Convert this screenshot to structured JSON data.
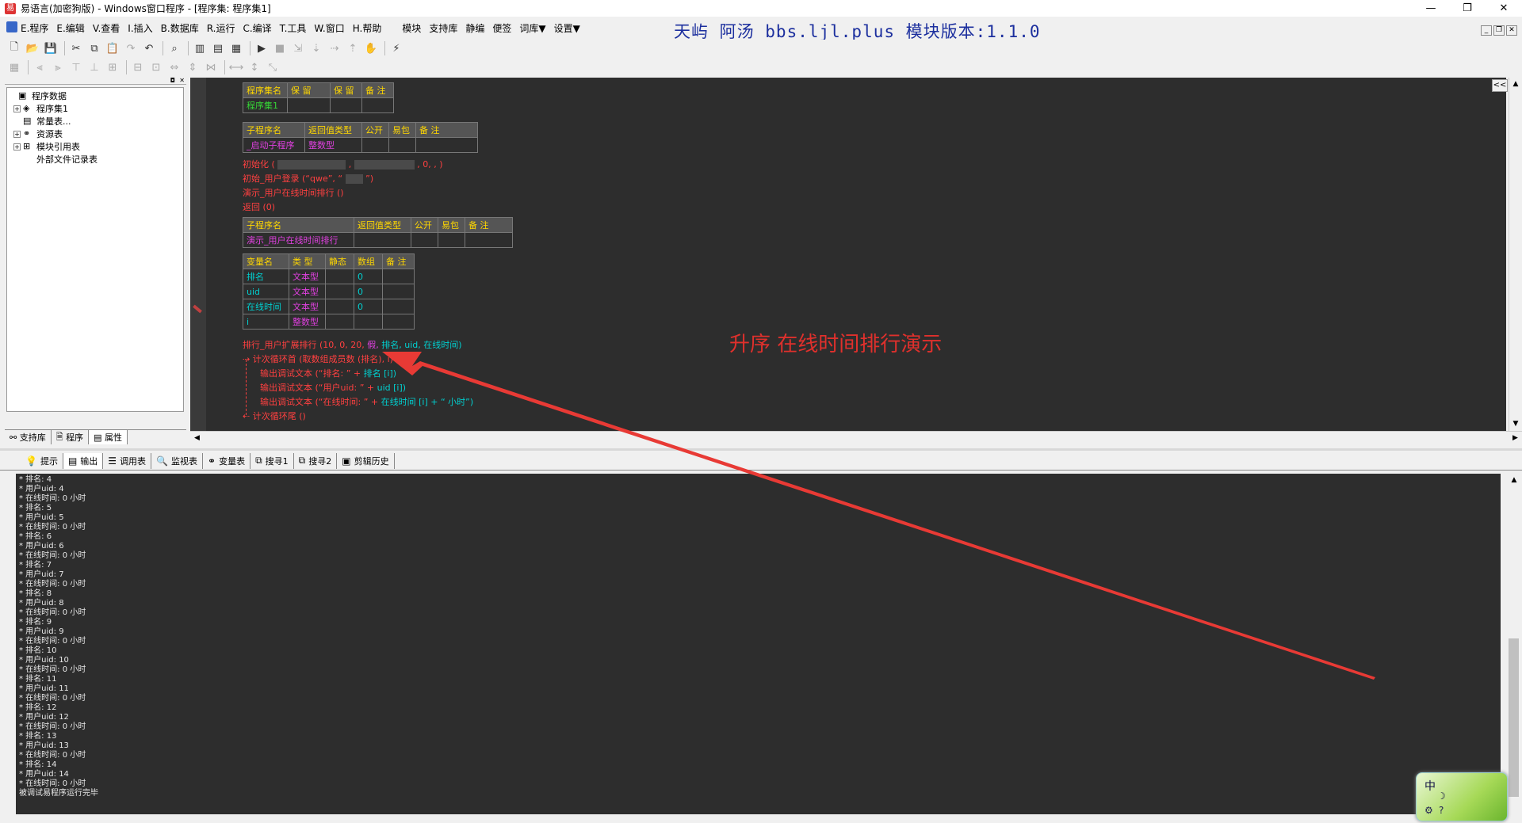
{
  "window": {
    "title": "易语言(加密狗版) - Windows窗口程序 - [程序集: 程序集1]",
    "minimize": "—",
    "restore": "❐",
    "close": "✕"
  },
  "menu": {
    "items": [
      "E.程序",
      "E.编辑",
      "V.查看",
      "I.插入",
      "B.数据库",
      "R.运行",
      "C.编译",
      "T.工具",
      "W.窗口",
      "H.帮助",
      "模块",
      "支持库",
      "静编",
      "便签",
      "词库▼",
      "设置▼"
    ],
    "banner": "天屿_阿汤 bbs.ljl.plus 模块版本:1.1.0",
    "mdi": [
      "_",
      "❐",
      "✕"
    ]
  },
  "left_panel": {
    "tree": [
      {
        "label": "程序数据",
        "icon": "▣",
        "level": 0,
        "exp": ""
      },
      {
        "label": "程序集1",
        "icon": "◈",
        "level": 1,
        "exp": "+"
      },
      {
        "label": "常量表...",
        "icon": "▤",
        "level": 1,
        "exp": ""
      },
      {
        "label": "资源表",
        "icon": "⚭",
        "level": 1,
        "exp": "+"
      },
      {
        "label": "模块引用表",
        "icon": "⊞",
        "level": 1,
        "exp": "+"
      },
      {
        "label": "外部文件记录表",
        "icon": "",
        "level": 1,
        "exp": ""
      }
    ],
    "tabs": [
      "支持库",
      "程序",
      "属性"
    ]
  },
  "editor": {
    "t1_headers": [
      "程序集名",
      "保 留",
      "保 留",
      "备 注"
    ],
    "t1_row": [
      "程序集1",
      "",
      "",
      ""
    ],
    "t2_headers": [
      "子程序名",
      "返回值类型",
      "公开",
      "易包",
      "备 注"
    ],
    "t2_row": [
      "_启动子程序",
      "整数型",
      "",
      "",
      ""
    ],
    "line_init_a": "初始化 (",
    "line_init_b": ",",
    "line_init_c": ", 0, , )",
    "line_login_a": "初始_用户登录 (“qwe”, “",
    "line_login_b": "”)",
    "line_demo_call": "演示_用户在线时间排行 ()",
    "line_return": "返回 (0)",
    "t3_headers": [
      "子程序名",
      "返回值类型",
      "公开",
      "易包",
      "备 注"
    ],
    "t3_row": [
      "演示_用户在线时间排行",
      "",
      "",
      "",
      ""
    ],
    "t4_headers": [
      "变量名",
      "类 型",
      "静态",
      "数组",
      "备 注"
    ],
    "t4_rows": [
      [
        "排名",
        "文本型",
        "",
        "0",
        ""
      ],
      [
        "uid",
        "文本型",
        "",
        "0",
        ""
      ],
      [
        "在线时间",
        "文本型",
        "",
        "0",
        ""
      ],
      [
        "i",
        "整数型",
        "",
        "",
        ""
      ]
    ],
    "line_sort_a": "排行_用户扩展排行 (10, 0, 20,",
    "line_sort_b": "假,",
    "line_sort_c": "排名, uid, 在线时间)",
    "line_loop_a": "计次循环首 (取数组成员数 (排名), i)",
    "line_out1_a": "输出调试文本 (“排名: ” + ",
    "line_out1_b": "排名 [i])",
    "line_out2_a": "输出调试文本 (“用户uid: ” + ",
    "line_out2_b": "uid [i])",
    "line_out3_a": "输出调试文本 (“在线时间: ” + ",
    "line_out3_b": "在线时间 [i] + “ 小时”)",
    "line_loop_end": "计次循环尾 ()",
    "annotation": "升序 在线时间排行演示",
    "collapse": "<<"
  },
  "bottom_tabs": [
    {
      "label": "提示",
      "icon": "💡"
    },
    {
      "label": "输出",
      "icon": "▤"
    },
    {
      "label": "调用表",
      "icon": "☰"
    },
    {
      "label": "监视表",
      "icon": "🔍"
    },
    {
      "label": "变量表",
      "icon": "⚭"
    },
    {
      "label": "搜寻1",
      "icon": "⧉"
    },
    {
      "label": "搜寻2",
      "icon": "⧉"
    },
    {
      "label": "剪辑历史",
      "icon": "▣"
    }
  ],
  "output_lines": [
    "* 排名: 4",
    "* 用户uid: 4",
    "* 在线时间: 0 小时",
    "* 排名: 5",
    "* 用户uid: 5",
    "* 在线时间: 0 小时",
    "* 排名: 6",
    "* 用户uid: 6",
    "* 在线时间: 0 小时",
    "* 排名: 7",
    "* 用户uid: 7",
    "* 在线时间: 0 小时",
    "* 排名: 8",
    "* 用户uid: 8",
    "* 在线时间: 0 小时",
    "* 排名: 9",
    "* 用户uid: 9",
    "* 在线时间: 0 小时",
    "* 排名: 10",
    "* 用户uid: 10",
    "* 在线时间: 0 小时",
    "* 排名: 11",
    "* 用户uid: 11",
    "* 在线时间: 0 小时",
    "* 排名: 12",
    "* 用户uid: 12",
    "* 在线时间: 0 小时",
    "* 排名: 13",
    "* 用户uid: 13",
    "* 在线时间: 0 小时",
    "* 排名: 14",
    "* 用户uid: 14",
    "* 在线时间: 0 小时",
    "被调试易程序运行完毕"
  ],
  "ime": {
    "lang": "中",
    "moon": "☽",
    "gear": "⚙",
    "help": "?"
  },
  "colors": {
    "accent": "#1c2f9e",
    "annotation": "#e0302c",
    "editor_bg": "#2d2d2d"
  }
}
